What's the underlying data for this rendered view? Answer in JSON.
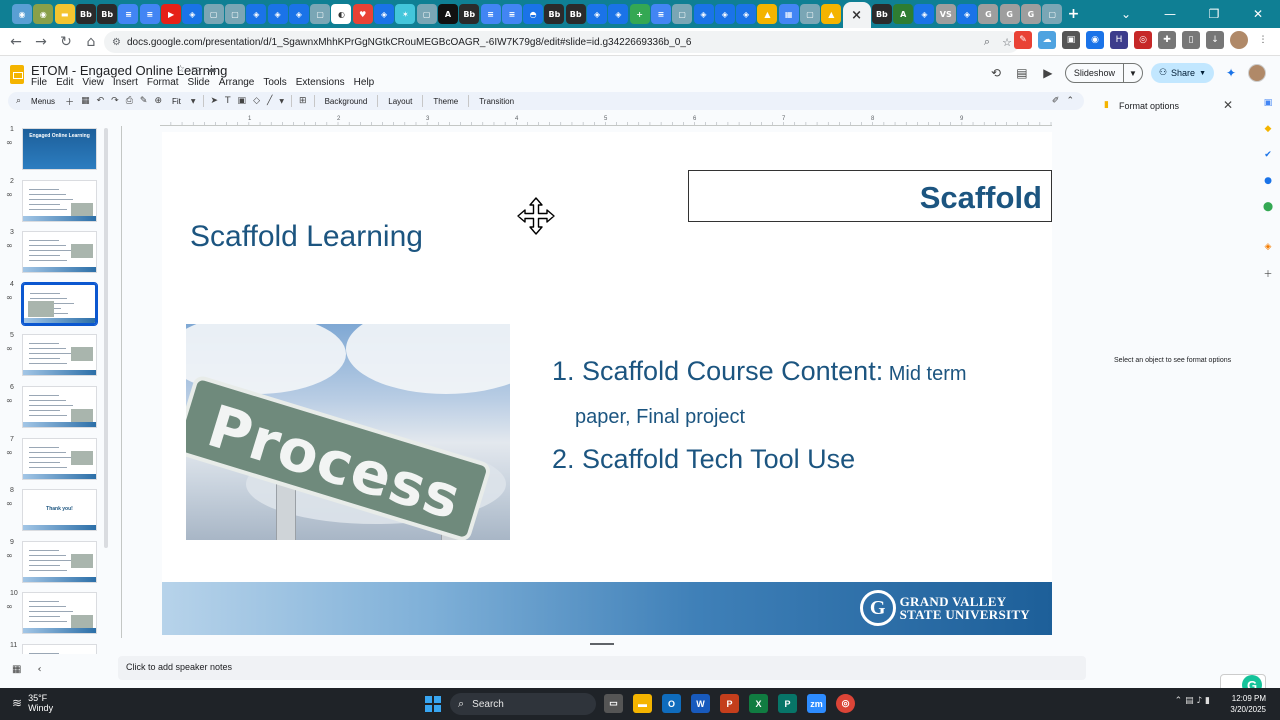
{
  "browser": {
    "url": "docs.google.com/presentation/d/1_SgawnxMhhKPrGgNGtkCRouMEGBcOAGR_-6IW7K79g8/edit#slide=id.g3422669336b_0_6",
    "active_tab_close": "×",
    "tabs": [
      {
        "icon": "apps",
        "color": "#5a9fd4"
      },
      {
        "icon": "apps",
        "color": "#8aa04a"
      },
      {
        "icon": "folder",
        "color": "#f4c430"
      },
      {
        "icon": "Bb",
        "color": "#2b2b2b"
      },
      {
        "icon": "Bb",
        "color": "#2b2b2b"
      },
      {
        "icon": "doc",
        "color": "#4285f4"
      },
      {
        "icon": "doc",
        "color": "#4285f4"
      },
      {
        "icon": "play",
        "color": "#e62117"
      },
      {
        "icon": "shield",
        "color": "#1a73e8"
      },
      {
        "icon": "tab",
        "color": "#7aa6b5"
      },
      {
        "icon": "tab",
        "color": "#7aa6b5"
      },
      {
        "icon": "shield",
        "color": "#1a73e8"
      },
      {
        "icon": "shield",
        "color": "#1a73e8"
      },
      {
        "icon": "shield",
        "color": "#1a73e8"
      },
      {
        "icon": "tab",
        "color": "#7aa6b5"
      },
      {
        "icon": "chat",
        "color": "#ffffff"
      },
      {
        "icon": "heart",
        "color": "#e94235"
      },
      {
        "icon": "shield",
        "color": "#1a73e8"
      },
      {
        "icon": "star",
        "color": "#43c6db"
      },
      {
        "icon": "tab",
        "color": "#7aa6b5"
      },
      {
        "icon": "A",
        "color": "#111111"
      },
      {
        "icon": "Bb",
        "color": "#2b2b2b"
      },
      {
        "icon": "doc",
        "color": "#4285f4"
      },
      {
        "icon": "doc",
        "color": "#4285f4"
      },
      {
        "icon": "bird",
        "color": "#1a73e8"
      },
      {
        "icon": "Bb",
        "color": "#2b2b2b"
      },
      {
        "icon": "Bb",
        "color": "#2b2b2b"
      },
      {
        "icon": "shield",
        "color": "#1a73e8"
      },
      {
        "icon": "shield",
        "color": "#1a73e8"
      },
      {
        "icon": "plus",
        "color": "#34a853"
      },
      {
        "icon": "doc",
        "color": "#4285f4"
      },
      {
        "icon": "tab",
        "color": "#7aa6b5"
      },
      {
        "icon": "shield",
        "color": "#1a73e8"
      },
      {
        "icon": "shield",
        "color": "#1a73e8"
      },
      {
        "icon": "shield",
        "color": "#1a73e8"
      },
      {
        "icon": "drive",
        "color": "#f4b400"
      },
      {
        "icon": "board",
        "color": "#4285f4"
      },
      {
        "icon": "tab",
        "color": "#7aa6b5"
      },
      {
        "icon": "drive",
        "color": "#f4b400"
      }
    ],
    "tabs_after": [
      {
        "icon": "Bb",
        "color": "#2b2b2b"
      },
      {
        "icon": "A",
        "color": "#2e7d32"
      },
      {
        "icon": "shield",
        "color": "#1a73e8"
      },
      {
        "icon": "VS",
        "color": "#9e9e9e"
      },
      {
        "icon": "shield",
        "color": "#1a73e8"
      },
      {
        "icon": "G",
        "color": "#9e9e9e"
      },
      {
        "icon": "G",
        "color": "#9e9e9e"
      },
      {
        "icon": "G",
        "color": "#9e9e9e"
      },
      {
        "icon": "tab",
        "color": "#7aa6b5"
      }
    ],
    "new_tab": "+"
  },
  "app": {
    "doc_title": "ETOM - Engaged Online Learning",
    "menus": [
      "File",
      "Edit",
      "View",
      "Insert",
      "Format",
      "Slide",
      "Arrange",
      "Tools",
      "Extensions",
      "Help"
    ],
    "slideshow_label": "Slideshow",
    "share_label": "Share"
  },
  "toolbar": {
    "menus_label": "Menus",
    "zoom_label": "Fit",
    "background_label": "Background",
    "layout_label": "Layout",
    "theme_label": "Theme",
    "transition_label": "Transition"
  },
  "filmstrip": {
    "slides": [
      {
        "num": "1",
        "title": "Engaged Online Learning"
      },
      {
        "num": "2"
      },
      {
        "num": "3"
      },
      {
        "num": "4"
      },
      {
        "num": "5"
      },
      {
        "num": "6"
      },
      {
        "num": "7"
      },
      {
        "num": "8",
        "title": "Thank you!"
      },
      {
        "num": "9"
      },
      {
        "num": "10"
      },
      {
        "num": "11"
      }
    ]
  },
  "ruler": {
    "marks": [
      "1",
      "2",
      "3",
      "4",
      "5",
      "6",
      "7",
      "8",
      "9"
    ]
  },
  "slide": {
    "title": "Scaffold Learning",
    "box_text": "Scaffold",
    "image_text": "Process",
    "item1_main": "1. Scaffold Course Content:",
    "item1_small": " Mid term",
    "item1_cont": "paper, Final project",
    "item2": "2. Scaffold Tech Tool Use",
    "logo_line1": "GRAND VALLEY",
    "logo_line2": "STATE UNIVERSITY"
  },
  "notes": {
    "placeholder": "Click to add speaker notes"
  },
  "format_panel": {
    "title": "Format options",
    "message": "Select an object to see format options"
  },
  "taskbar": {
    "temp": "35°F",
    "condition": "Windy",
    "search_label": "Search",
    "time": "12:09 PM",
    "date": "3/20/2025"
  }
}
